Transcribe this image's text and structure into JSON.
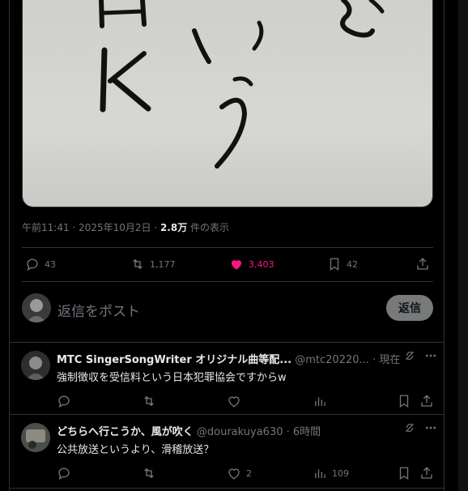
{
  "tweet": {
    "meta": {
      "time": "午前11:41",
      "sep1": " · ",
      "date": "2025年10月2日",
      "sep2": " · ",
      "views_count": "2.8万",
      "views_label": " 件の表示"
    },
    "actions": {
      "replies": "43",
      "retweets": "1,177",
      "likes": "3,403",
      "bookmarks": "42"
    },
    "like_color": "#f91880"
  },
  "composer": {
    "placeholder": "返信をポスト",
    "button_label": "返信"
  },
  "replies": [
    {
      "name": "MTC SingerSongWriter オリジナル曲等配...",
      "handle": "@mtc20220...",
      "time": "· 現在",
      "text": "強制徴収を受信料という日本犯罪協会ですからw",
      "likes": "",
      "views": ""
    },
    {
      "name": "どちらへ行こうか、風が吹く",
      "handle": "@dourakuya630",
      "time": "· 6時間",
      "text": "公共放送というより、滑稽放送？",
      "likes": "2",
      "views": "109"
    }
  ]
}
